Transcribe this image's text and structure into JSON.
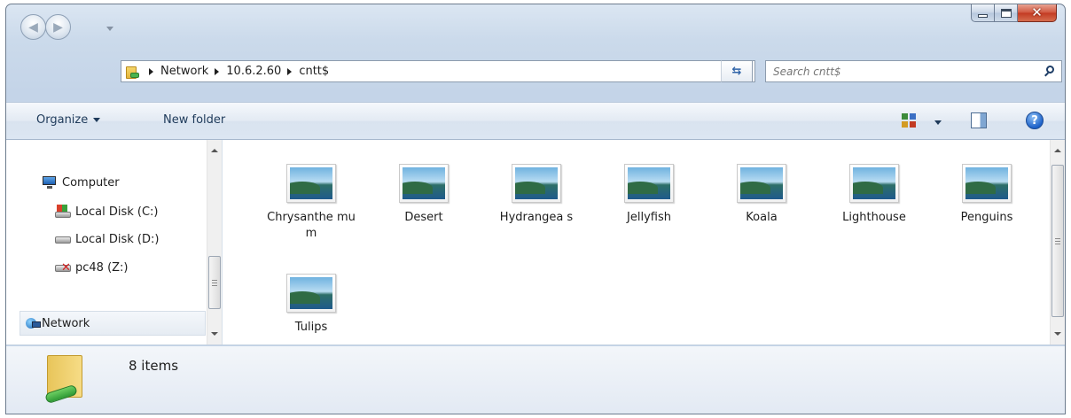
{
  "window": {
    "caption_buttons": {
      "minimize": "minimize",
      "maximize": "maximize",
      "close": "✕"
    }
  },
  "nav": {
    "back_icon": "back-arrow-icon",
    "forward_icon": "forward-arrow-icon"
  },
  "address": {
    "crumbs": [
      "Network",
      "10.6.2.60",
      "cntt$"
    ]
  },
  "search": {
    "placeholder": "Search cntt$"
  },
  "toolbar": {
    "organize_label": "Organize",
    "new_folder_label": "New folder"
  },
  "nav_pane": {
    "computer": "Computer",
    "local_c": "Local Disk (C:)",
    "local_d": "Local Disk (D:)",
    "pc48": "pc48  (Z:)",
    "network": "Network"
  },
  "files": [
    {
      "name": "Chrysanthe mum"
    },
    {
      "name": "Desert"
    },
    {
      "name": "Hydrangea s"
    },
    {
      "name": "Jellyfish"
    },
    {
      "name": "Koala"
    },
    {
      "name": "Lighthouse"
    },
    {
      "name": "Penguins"
    },
    {
      "name": "Tulips"
    }
  ],
  "status": {
    "item_count": "8 items"
  },
  "colors": {
    "accent": "#2f63a8",
    "close_red": "#c23a22",
    "chrome": "#cbdaeb"
  }
}
